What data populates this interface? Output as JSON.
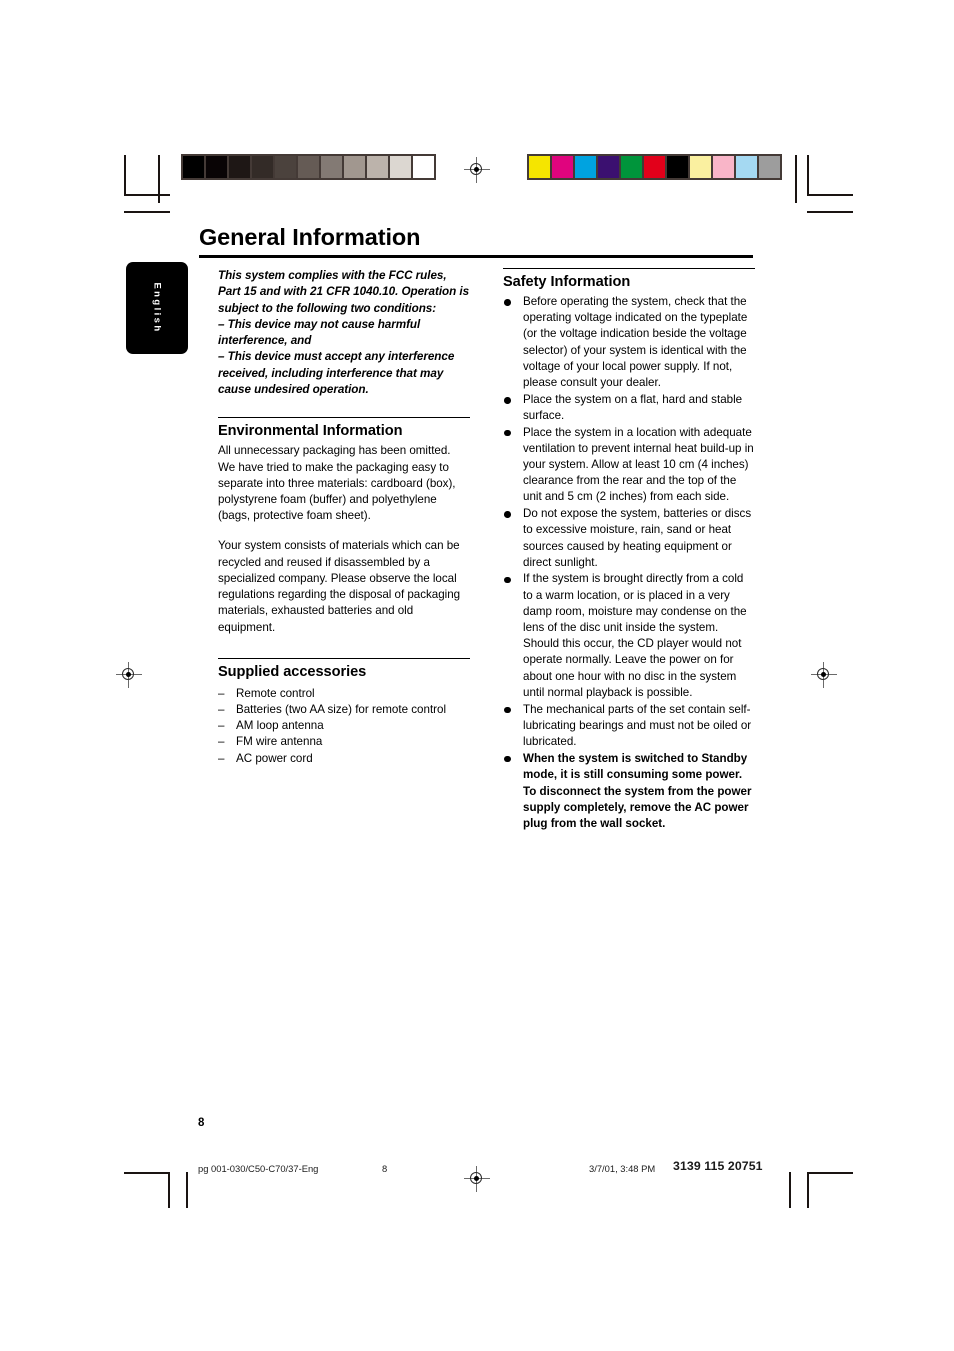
{
  "document": {
    "title": "General Information",
    "page_number": "8",
    "language_tab": "English"
  },
  "calibration": {
    "grayscale_label": "grayscale-calibration-bar",
    "grayscale_swatches": [
      "#000000",
      "#090405",
      "#1e1715",
      "#332b27",
      "#4b423d",
      "#655b55",
      "#837a74",
      "#a1978f",
      "#bcb3ab",
      "#dcd7d1",
      "#ffffff"
    ],
    "color_label": "color-calibration-bar",
    "color_swatches": [
      "#f5e500",
      "#e0047e",
      "#00a3e0",
      "#3b1070",
      "#00953b",
      "#e2001a",
      "#000000",
      "#faf0a0",
      "#f9b5c8",
      "#a5d9f2",
      "#9d9d9d"
    ]
  },
  "left_column": {
    "fcc_notice": "This system complies with the FCC rules, Part 15 and with 21 CFR 1040.10. Operation is subject to the following two conditions:\n–  This device may not cause harmful interference, and\n–  This device must accept any interference received, including interference that may cause undesired operation.",
    "environmental": {
      "heading": "Environmental Information",
      "paragraphs": [
        "All unnecessary packaging has been omitted. We have tried to make the packaging easy to separate into three materials: cardboard (box), polystyrene foam (buffer) and polyethylene (bags, protective foam sheet).",
        "Your system consists of materials which can be recycled and reused if disassembled by a specialized company. Please observe the local regulations regarding the disposal of packaging materials, exhausted batteries and old equipment."
      ]
    },
    "accessories": {
      "heading": "Supplied accessories",
      "dash": "–",
      "items": [
        "Remote control",
        "Batteries (two AA size) for remote control",
        "AM loop antenna",
        "FM wire antenna",
        "AC power cord"
      ]
    }
  },
  "right_column": {
    "safety": {
      "heading": "Safety Information",
      "items": [
        {
          "text": "Before operating the system, check that the operating voltage indicated on the typeplate (or the voltage indication beside the voltage selector) of your system is identical with the voltage of your local power supply. If not, please consult your dealer.",
          "bold": false
        },
        {
          "text": "Place the system on a flat, hard and stable surface.",
          "bold": false
        },
        {
          "text": "Place the system in a location with adequate ventilation to prevent internal heat build-up in your system. Allow at least 10 cm (4 inches) clearance from the rear and the top of the unit and 5 cm (2 inches) from each side.",
          "bold": false
        },
        {
          "text": "Do not expose the system, batteries or discs to excessive moisture, rain, sand or heat sources caused by heating equipment or direct sunlight.",
          "bold": false
        },
        {
          "text": "If the system is brought directly from a cold to a warm location, or is placed in a very damp room, moisture may condense on the lens of the disc unit inside the system. Should this occur, the CD player would not operate normally. Leave the power on for about one hour with no disc in the system until normal playback is possible.",
          "bold": false
        },
        {
          "text": "The mechanical parts of the set contain self-lubricating bearings and must not be oiled or lubricated.",
          "bold": false
        },
        {
          "text": "When the system is switched to Standby mode, it is still consuming some power. To disconnect the system from the power supply completely, remove the AC power plug from the wall socket.",
          "bold": true
        }
      ]
    }
  },
  "footer": {
    "file_reference": "pg 001-030/C50-C70/37-Eng",
    "page_number": "8",
    "timestamp": "3/7/01, 3:48 PM",
    "job_code": "3139 115 20751"
  }
}
